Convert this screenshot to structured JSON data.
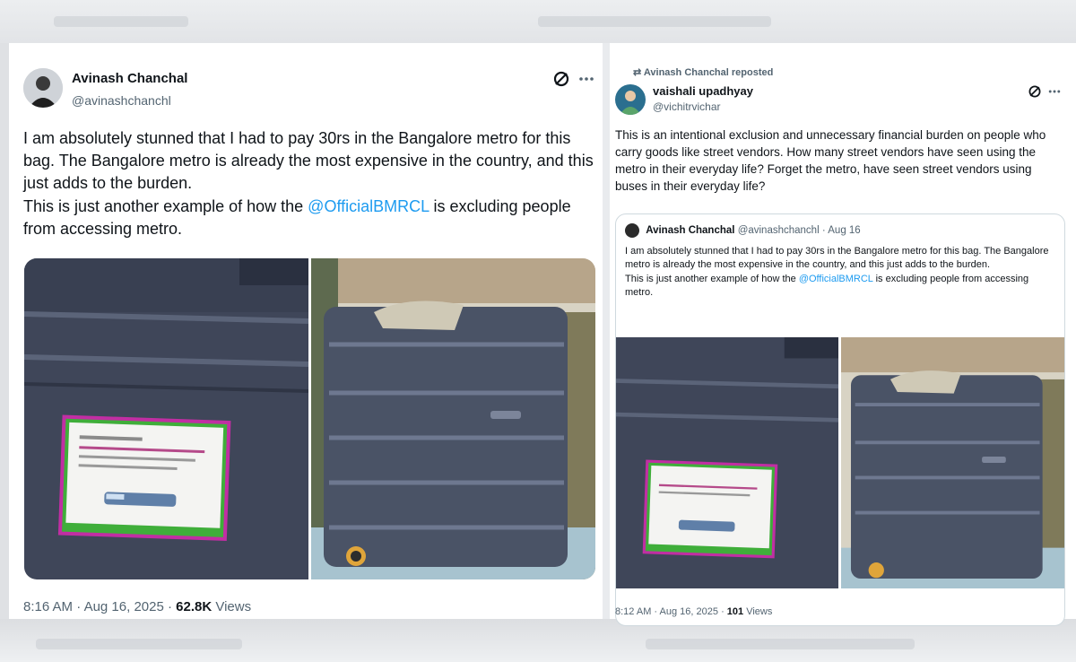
{
  "left_tweet": {
    "author_name": "Avinash Chanchal",
    "author_handle": "@avinashchanchl",
    "grok_icon": "grok-icon",
    "more_icon": "more-icon",
    "text_before_mention": "I am absolutely stunned that I had to pay 30rs in the Bangalore metro for this bag. The Bangalore metro is already the most expensive in the country, and this just adds to the burden.\nThis is just another example of how the ",
    "mention": "@OfficialBMRCL",
    "text_after_mention": " is excluding people from accessing metro.",
    "time": "8:16 AM",
    "date": "Aug 16, 2025",
    "views_count": "62.8K",
    "views_label": "Views",
    "separator": "·"
  },
  "right_tweet": {
    "repost_label": "Avinash Chanchal reposted",
    "repost_icon": "repost-icon",
    "author_name": "vaishali upadhyay",
    "author_handle": "@vichitrvichar",
    "grok_icon": "grok-icon",
    "text": "This is an intentional exclusion and unnecessary financial burden on people who carry goods like street vendors. How many street vendors have seen using the metro in their everyday life? Forget the metro, have seen street vendors using buses in their everyday life?",
    "quote": {
      "author_name": "Avinash Chanchal",
      "author_handle": "@avinashchanchl",
      "date": "Aug 16",
      "separator": "·",
      "text_before_mention": "I am absolutely stunned that I had to pay 30rs in the Bangalore metro for this bag. The Bangalore metro is already the most expensive in the country, and this just adds to the burden.\nThis is just another example of how the ",
      "mention": "@OfficialBMRCL",
      "text_after_mention": " is excluding people from accessing metro."
    },
    "time": "8:12 AM",
    "date": "Aug 16, 2025",
    "views_count": "101",
    "views_label": "Views",
    "separator": "·"
  },
  "colors": {
    "accent": "#1d9bf0",
    "text": "#0f1419",
    "muted": "#536471",
    "suitcase": "#4a5366",
    "tag_pink": "#c12ea3",
    "tag_green": "#3fae3a"
  }
}
